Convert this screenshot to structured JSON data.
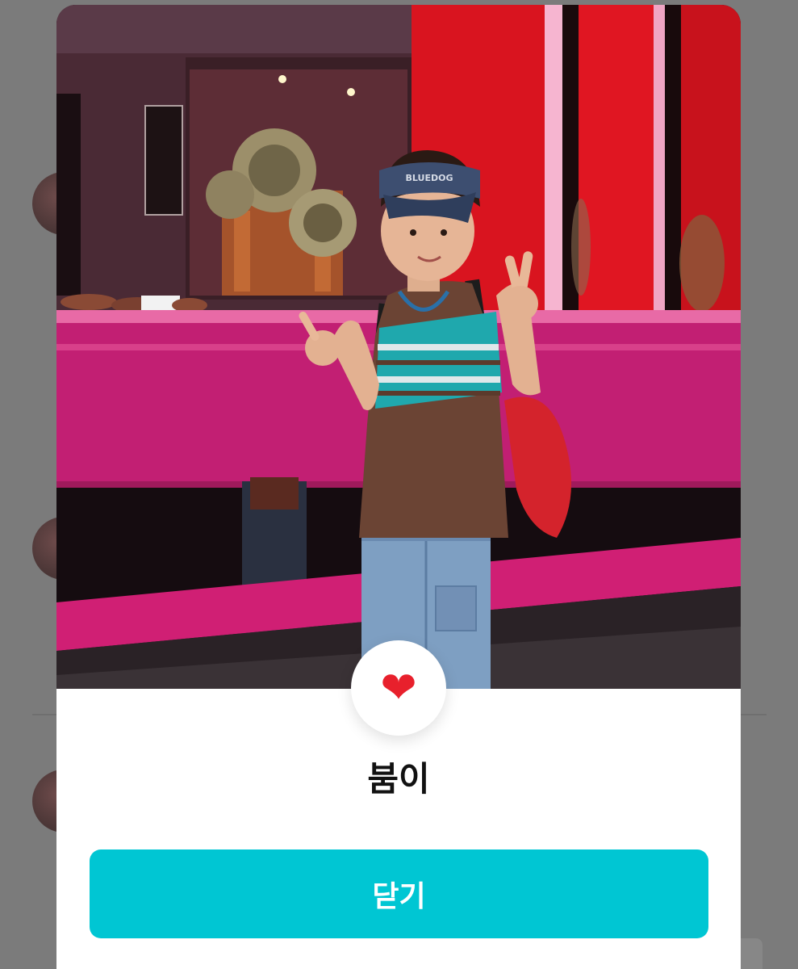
{
  "dialog": {
    "reaction_icon": "red-heart-icon",
    "reaction_glyph": "❤",
    "name": "붐이",
    "close_label": "닫기"
  },
  "colors": {
    "button": "#00c6d3",
    "overlay": "#7b7b7b",
    "heart": "#e8202c"
  }
}
